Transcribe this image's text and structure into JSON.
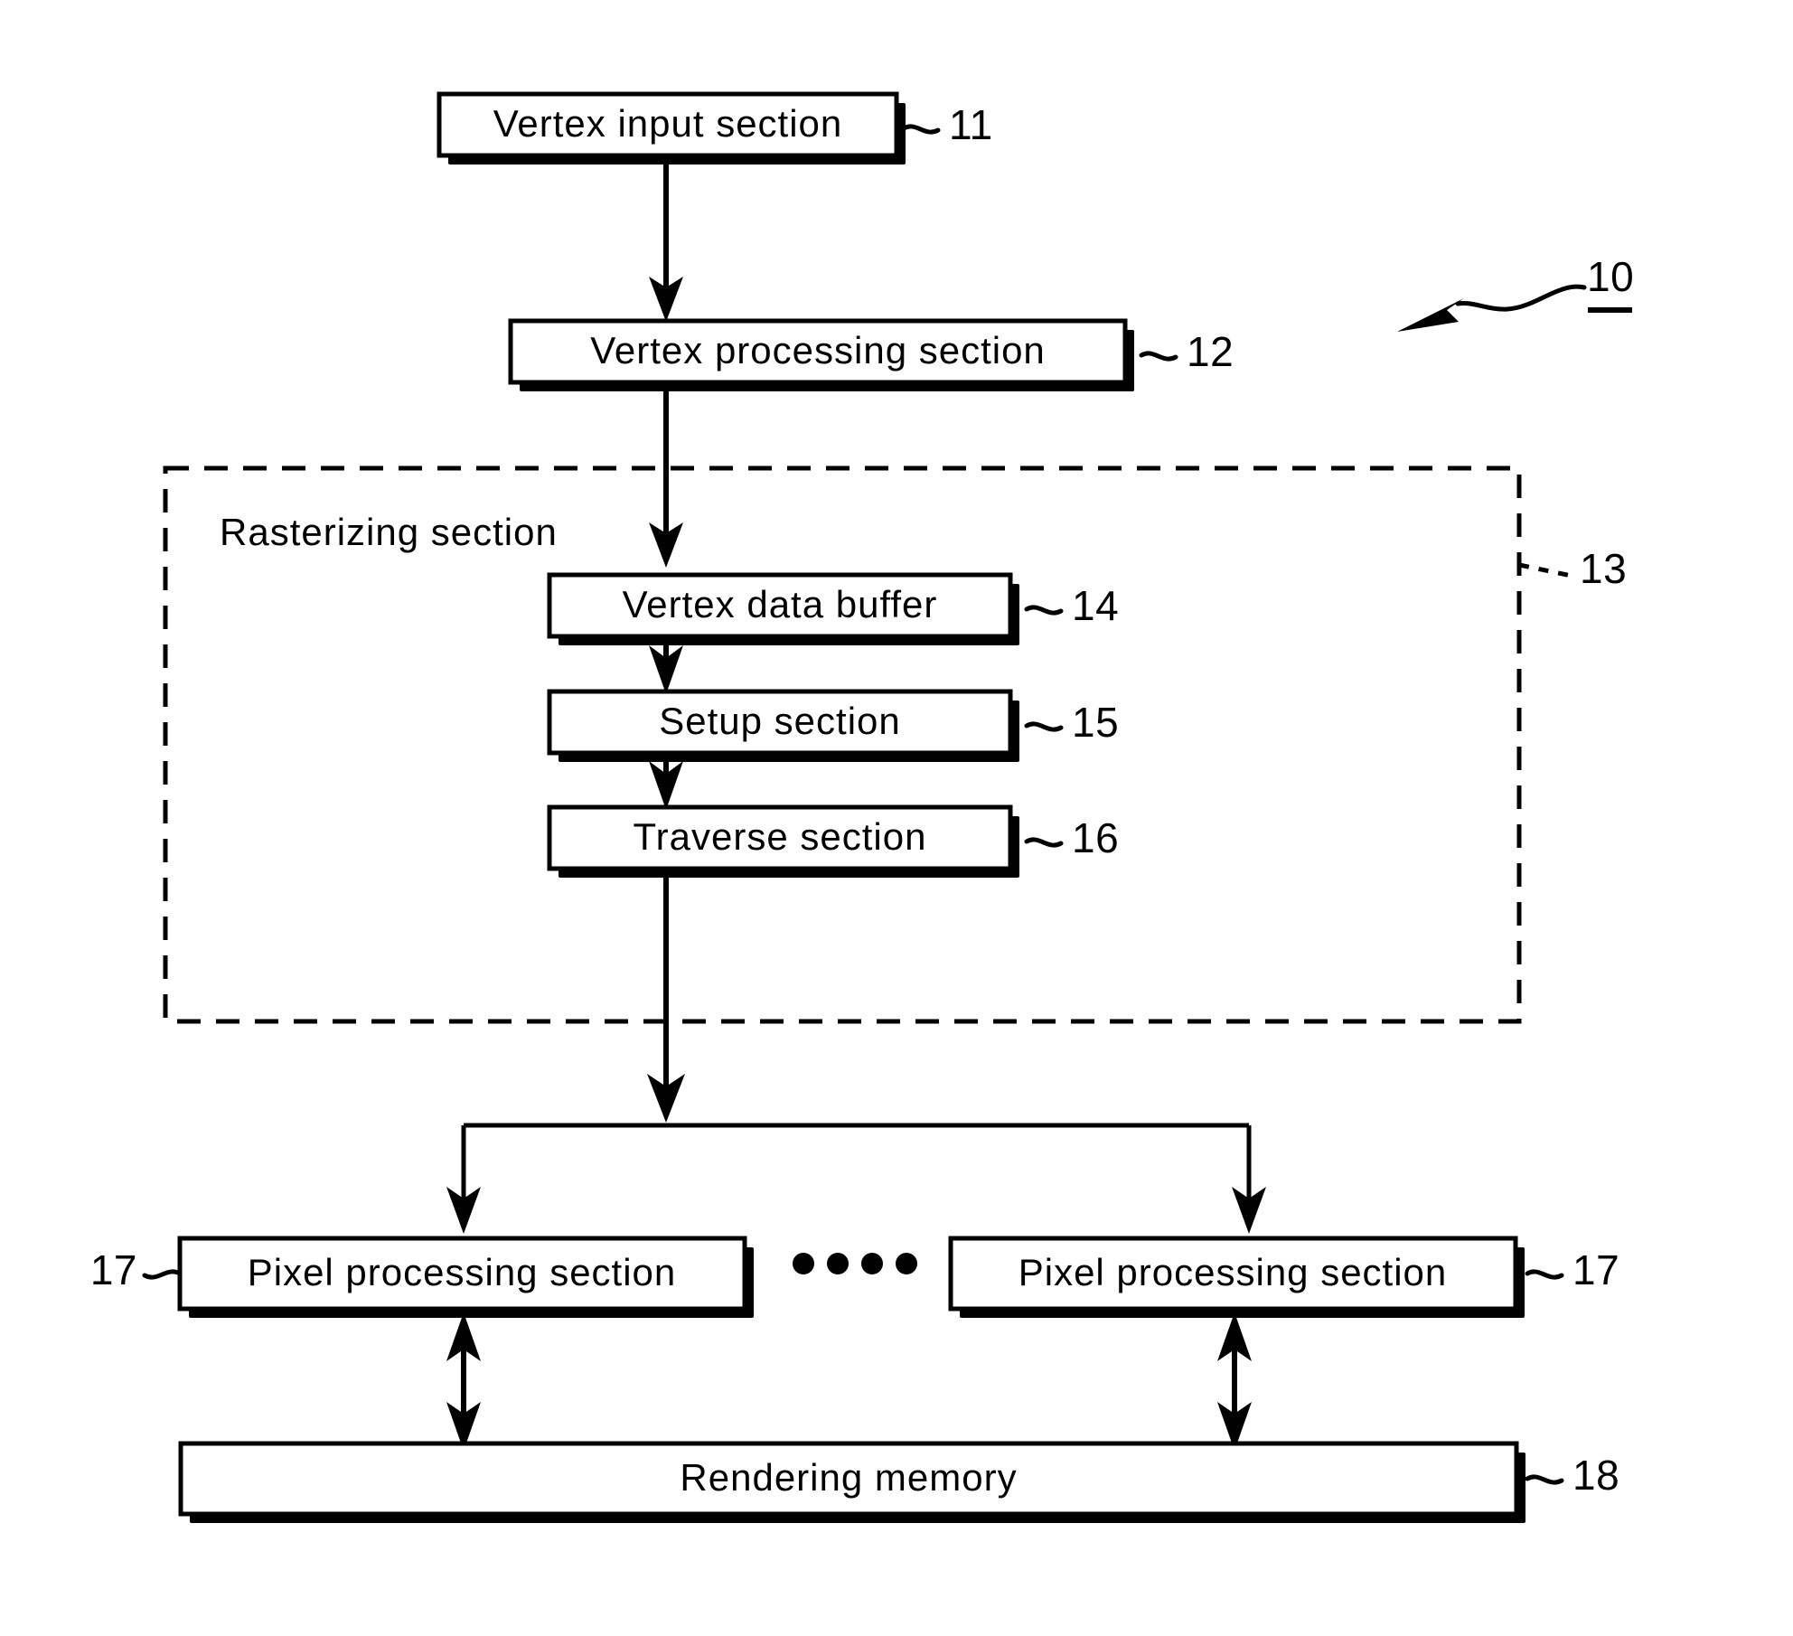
{
  "figure": {
    "kind": "patent-block-diagram",
    "overall_ref": "10",
    "nodes": {
      "vertex_input": {
        "label": "Vertex input section",
        "ref": "11"
      },
      "vertex_processing": {
        "label": "Vertex processing section",
        "ref": "12"
      },
      "rasterizing": {
        "label": "Rasterizing section",
        "ref": "13"
      },
      "vertex_data_buffer": {
        "label": "Vertex data buffer",
        "ref": "14"
      },
      "setup": {
        "label": "Setup section",
        "ref": "15"
      },
      "traverse": {
        "label": "Traverse section",
        "ref": "16"
      },
      "pixel_left": {
        "label": "Pixel processing section",
        "ref": "17"
      },
      "pixel_right": {
        "label": "Pixel processing section",
        "ref": "17"
      },
      "rendering_memory": {
        "label": "Rendering memory",
        "ref": "18"
      }
    },
    "ellipsis_dots": 4,
    "colors": {
      "ink": "#000000",
      "paper": "#ffffff"
    }
  }
}
